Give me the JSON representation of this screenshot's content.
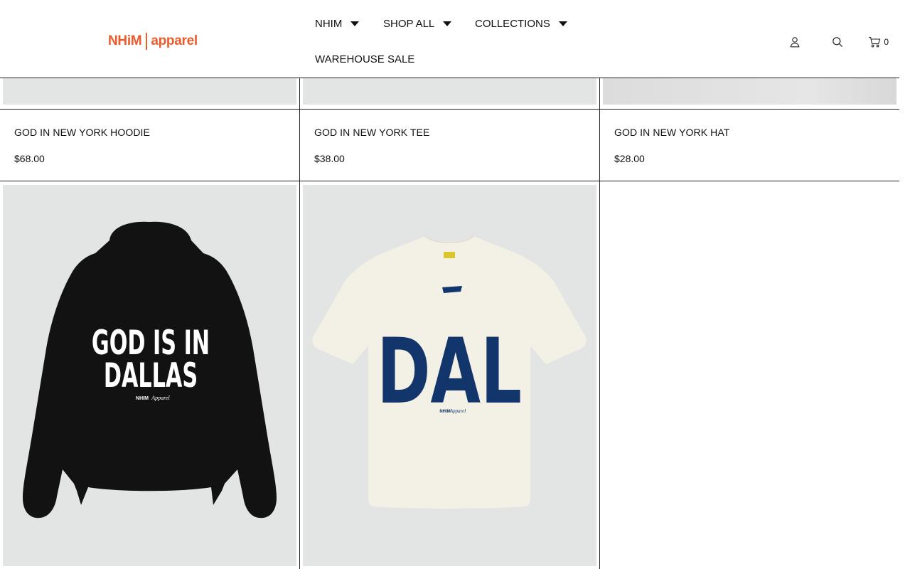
{
  "brand": {
    "logo_left": "NHiM",
    "logo_right": "apparel",
    "color": "#ee5a2c"
  },
  "nav": {
    "items": [
      {
        "label": "NHIM",
        "has_dropdown": true
      },
      {
        "label": "SHOP ALL",
        "has_dropdown": true
      },
      {
        "label": "COLLECTIONS",
        "has_dropdown": true
      },
      {
        "label": "WAREHOUSE SALE",
        "has_dropdown": false
      }
    ]
  },
  "header_icons": {
    "account": "user-icon",
    "search": "search-icon",
    "cart": "cart-icon",
    "cart_count": "0"
  },
  "products_row1": [
    {
      "title": "GOD IN NEW YORK HOODIE",
      "price": "$68.00"
    },
    {
      "title": "GOD IN NEW YORK TEE",
      "price": "$38.00"
    },
    {
      "title": "GOD IN NEW YORK HAT",
      "price": "$28.00"
    }
  ],
  "products_row2": [
    {
      "type": "hoodie",
      "print_line1": "GOD IS IN",
      "print_line2": "DALLAS",
      "tag": "NHIM",
      "tag_script": "Apparel",
      "garment_color": "#121212",
      "print_color": "#ffffff"
    },
    {
      "type": "tee",
      "print_line1": "DAL",
      "tag": "NHIM",
      "tag_script": "Apparel",
      "garment_color": "#f3f0e6",
      "print_color": "#12356b"
    }
  ],
  "colors": {
    "border": "#222222",
    "image_bg": "#e3e5e5",
    "text": "#111111"
  }
}
